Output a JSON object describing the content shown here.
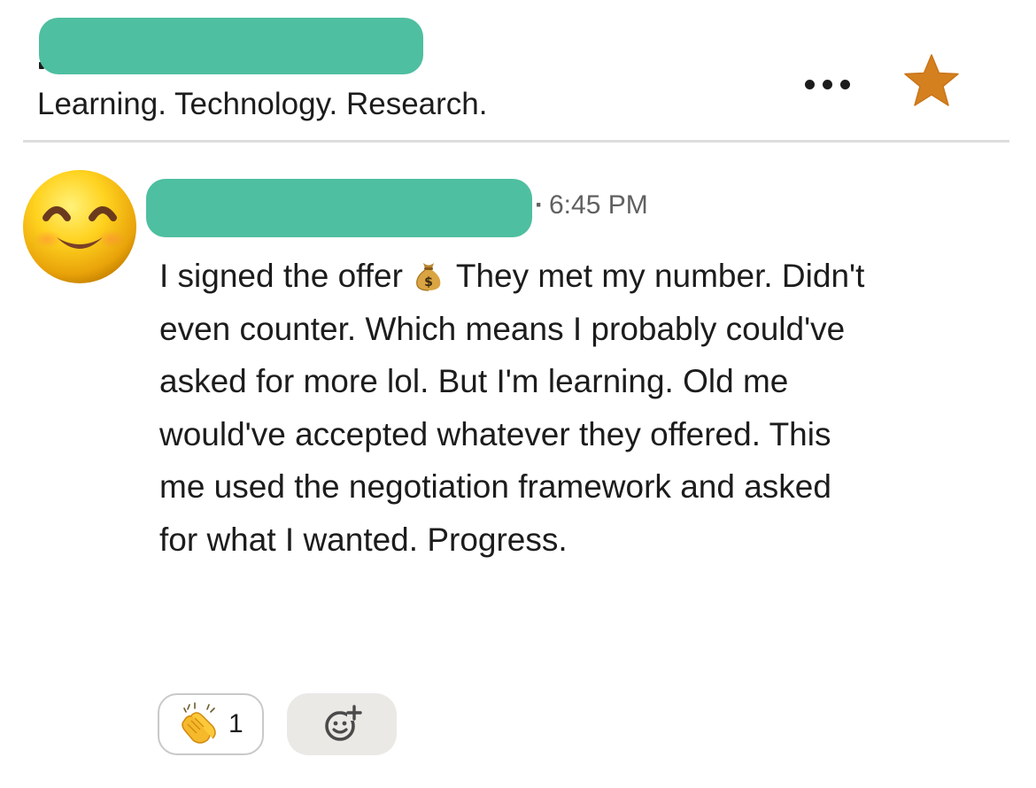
{
  "header": {
    "topic": "Learning. Technology. Research.",
    "more_icon": "more-horizontal-icon",
    "star_icon": "star-icon",
    "star_color": "#d5801e"
  },
  "message": {
    "timestamp": "6:45 PM",
    "avatar_icon": "smiling-face-emoji",
    "body_part1": "I signed the offer",
    "body_emoji": "money-bag-emoji",
    "body_part2": "They met my number. Didn't even counter. Which means I probably could've asked for more lol. But I'm learning. Old me would've accepted whatever they offered. This me used the negotiation framework and asked for what I wanted. Progress.",
    "reactions": [
      {
        "emoji": "clapping-hands-emoji",
        "count": "1"
      }
    ],
    "add_reaction_icon": "add-reaction-icon"
  },
  "colors": {
    "redaction": "#4ebfa0",
    "text": "#1d1c1d",
    "muted": "#616061",
    "divider": "#dddddd",
    "add_reaction_bg": "#ebe9e6"
  }
}
